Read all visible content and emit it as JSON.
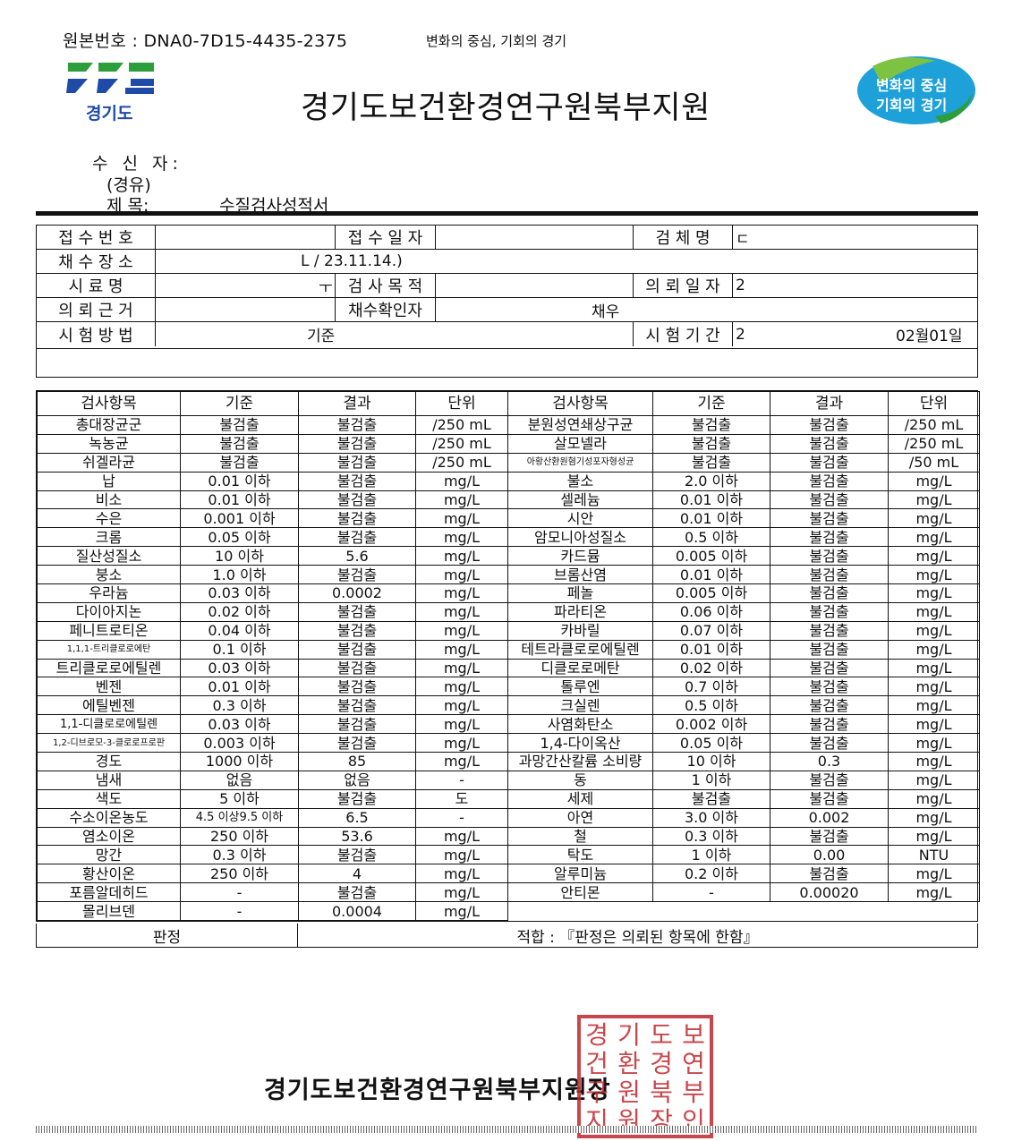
{
  "header": {
    "original_number": "원본번호 : DNA0-7D15-4435-2375",
    "slogan": "변화의 중심, 기회의 경기",
    "province_logo_text": "경기도",
    "org_title": "경기도보건환경연구원북부지원",
    "right_logo_line1": "변화의 중심",
    "right_logo_line2": "기회의 경기",
    "brand_colors": {
      "province_blue": "#1f4aa8",
      "province_green": "#2e9e3c",
      "badge_blue": "#1ea0d8",
      "badge_green": "#7cc243"
    }
  },
  "meta": {
    "recipient_label": "수 신 자:",
    "via_label": "(경유)",
    "subject_label": "제 목:",
    "subject_value": "수질검사성적서"
  },
  "info": {
    "receipt_no_label": "접 수 번 호",
    "receipt_date_label": "접 수 일 자",
    "sample_name_label": "검 체 명",
    "sample_name_value_fragment": "ㄷ",
    "collect_place_label": "채 수 장 소",
    "collect_place_value_fragment": "L / 23.11.14.)",
    "specimen_label": "시 료 명",
    "specimen_value_fragment": "ㅜ",
    "purpose_label": "검 사 목 적",
    "request_date_label": "의 뢰 일 자",
    "request_date_value_fragment": "2",
    "basis_label": "의 뢰 근 거",
    "confirmer_label": "채수확인자",
    "confirmer_value_fragment": "채우",
    "method_label": "시 험 방 법",
    "method_value_fragment": "기준",
    "period_label": "시 험 기 간",
    "period_value_fragment": "2",
    "period_end_fragment": "02월01일"
  },
  "results": {
    "headers": [
      "검사항목",
      "기준",
      "결과",
      "단위",
      "검사항목",
      "기준",
      "결과",
      "단위"
    ],
    "rows": [
      [
        "총대장균군",
        "불검출",
        "불검출",
        "/250 mL",
        "분원성연쇄상구균",
        "불검출",
        "불검출",
        "/250 mL"
      ],
      [
        "녹농균",
        "불검출",
        "불검출",
        "/250 mL",
        "살모넬라",
        "불검출",
        "불검출",
        "/250 mL"
      ],
      [
        "쉬겔라균",
        "불검출",
        "불검출",
        "/250 mL",
        "아황산환원혐기성포자형성균",
        "불검출",
        "불검출",
        "/50 mL"
      ],
      [
        "납",
        "0.01 이하",
        "불검출",
        "mg/L",
        "불소",
        "2.0 이하",
        "불검출",
        "mg/L"
      ],
      [
        "비소",
        "0.01 이하",
        "불검출",
        "mg/L",
        "셀레늄",
        "0.01 이하",
        "불검출",
        "mg/L"
      ],
      [
        "수은",
        "0.001 이하",
        "불검출",
        "mg/L",
        "시안",
        "0.01 이하",
        "불검출",
        "mg/L"
      ],
      [
        "크롬",
        "0.05 이하",
        "불검출",
        "mg/L",
        "암모니아성질소",
        "0.5 이하",
        "불검출",
        "mg/L"
      ],
      [
        "질산성질소",
        "10 이하",
        "5.6",
        "mg/L",
        "카드뮴",
        "0.005 이하",
        "불검출",
        "mg/L"
      ],
      [
        "붕소",
        "1.0 이하",
        "불검출",
        "mg/L",
        "브롬산염",
        "0.01 이하",
        "불검출",
        "mg/L"
      ],
      [
        "우라늄",
        "0.03 이하",
        "0.0002",
        "mg/L",
        "페놀",
        "0.005 이하",
        "불검출",
        "mg/L"
      ],
      [
        "다이아지논",
        "0.02 이하",
        "불검출",
        "mg/L",
        "파라티온",
        "0.06 이하",
        "불검출",
        "mg/L"
      ],
      [
        "페니트로티온",
        "0.04 이하",
        "불검출",
        "mg/L",
        "카바릴",
        "0.07 이하",
        "불검출",
        "mg/L"
      ],
      [
        "1,1,1-트리클로로에탄",
        "0.1 이하",
        "불검출",
        "mg/L",
        "테트라클로로에틸렌",
        "0.01 이하",
        "불검출",
        "mg/L"
      ],
      [
        "트리클로로에틸렌",
        "0.03 이하",
        "불검출",
        "mg/L",
        "디클로로메탄",
        "0.02 이하",
        "불검출",
        "mg/L"
      ],
      [
        "벤젠",
        "0.01 이하",
        "불검출",
        "mg/L",
        "톨루엔",
        "0.7 이하",
        "불검출",
        "mg/L"
      ],
      [
        "에틸벤젠",
        "0.3 이하",
        "불검출",
        "mg/L",
        "크실렌",
        "0.5 이하",
        "불검출",
        "mg/L"
      ],
      [
        "1,1-디클로로에틸렌",
        "0.03 이하",
        "불검출",
        "mg/L",
        "사염화탄소",
        "0.002 이하",
        "불검출",
        "mg/L"
      ],
      [
        "1,2-디브로모-3-클로로프로판",
        "0.003 이하",
        "불검출",
        "mg/L",
        "1,4-다이옥산",
        "0.05 이하",
        "불검출",
        "mg/L"
      ],
      [
        "경도",
        "1000 이하",
        "85",
        "mg/L",
        "과망간산칼륨 소비량",
        "10 이하",
        "0.3",
        "mg/L"
      ],
      [
        "냄새",
        "없음",
        "없음",
        "-",
        "동",
        "1 이하",
        "불검출",
        "mg/L"
      ],
      [
        "색도",
        "5 이하",
        "불검출",
        "도",
        "세제",
        "불검출",
        "불검출",
        "mg/L"
      ],
      [
        "수소이온농도",
        "4.5 이상9.5 이하",
        "6.5",
        "-",
        "아연",
        "3.0 이하",
        "0.002",
        "mg/L"
      ],
      [
        "염소이온",
        "250 이하",
        "53.6",
        "mg/L",
        "철",
        "0.3 이하",
        "불검출",
        "mg/L"
      ],
      [
        "망간",
        "0.3 이하",
        "불검출",
        "mg/L",
        "탁도",
        "1 이하",
        "0.00",
        "NTU"
      ],
      [
        "황산이온",
        "250 이하",
        "4",
        "mg/L",
        "알루미늄",
        "0.2 이하",
        "불검출",
        "mg/L"
      ],
      [
        "포름알데히드",
        "-",
        "불검출",
        "mg/L",
        "안티몬",
        "-",
        "0.00020",
        "mg/L"
      ],
      [
        "몰리브덴",
        "-",
        "0.0004",
        "mg/L",
        "",
        "",
        "",
        ""
      ]
    ],
    "judgement_label": "판정",
    "judgement_value": "적합 : 『판정은 의뢰된 항목에 한함』"
  },
  "footer": {
    "issuer": "경기도보건환경연구원북부지원장",
    "seal_chars": [
      "경",
      "기",
      "도",
      "보",
      "건",
      "환",
      "경",
      "연",
      "구",
      "원",
      "북",
      "부",
      "지",
      "원",
      "장",
      "인"
    ],
    "seal_color": "#c0272d"
  }
}
